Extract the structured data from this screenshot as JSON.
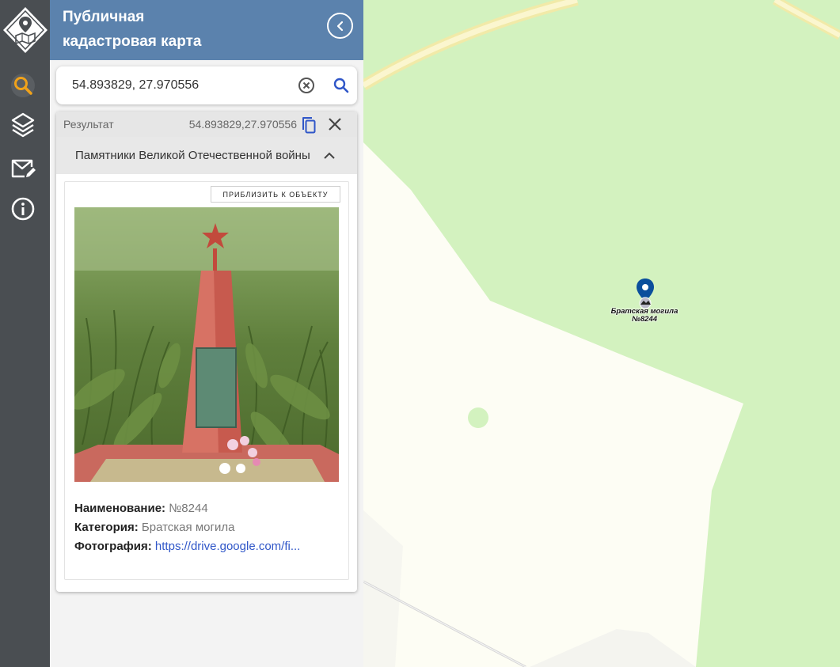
{
  "app": {
    "title_line1": "Публичная",
    "title_line2": "кадастровая карта"
  },
  "colors": {
    "rail": "#4a4e52",
    "header": "#5b82ad",
    "accent_search": "#f0a21a",
    "link": "#2f56c8",
    "map_green": "#d3f2bf",
    "map_cream": "#fdfdf4"
  },
  "toolbar": {
    "items": [
      {
        "icon": "search-icon",
        "active": true
      },
      {
        "icon": "layers-icon",
        "active": false
      },
      {
        "icon": "mail-edit-icon",
        "active": false
      },
      {
        "icon": "info-icon",
        "active": false
      }
    ]
  },
  "search": {
    "value": "54.893829, 27.970556",
    "placeholder": ""
  },
  "result": {
    "label": "Результат",
    "coords": "54.893829,27.970556",
    "section_title": "Памятники Великой Отечественной войны",
    "zoom_label": "ПРИБЛИЗИТЬ К ОБЪЕКТУ",
    "attributes": [
      {
        "key": "Наименование:",
        "value": "№8244"
      },
      {
        "key": "Категория:",
        "value": "Братская могила"
      },
      {
        "key": "Фотография:",
        "value": "https://drive.google.com/fi..."
      }
    ]
  },
  "map": {
    "marker_label_line1": "Братская могила",
    "marker_label_line2": "№8244"
  }
}
